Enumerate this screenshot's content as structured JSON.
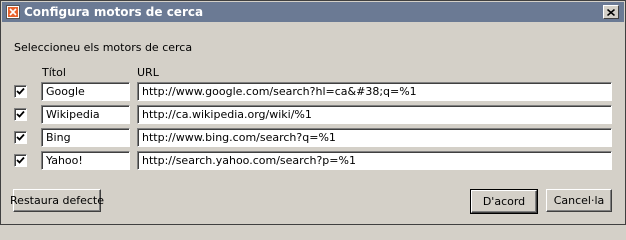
{
  "window": {
    "title": "Configura motors de cerca",
    "instruction": "Seleccioneu els motors de cerca"
  },
  "columns": {
    "title": "Títol",
    "url": "URL"
  },
  "engines": [
    {
      "checked": true,
      "title": "Google",
      "url": "http://www.google.com/search?hl=ca&#38;q=%1"
    },
    {
      "checked": true,
      "title": "Wikipedia",
      "url": "http://ca.wikipedia.org/wiki/%1"
    },
    {
      "checked": true,
      "title": "Bing",
      "url": "http://www.bing.com/search?q=%1"
    },
    {
      "checked": true,
      "title": "Yahoo!",
      "url": "http://search.yahoo.com/search?p=%1"
    }
  ],
  "buttons": {
    "restore": "Restaura defecte",
    "ok": "D'acord",
    "cancel": "Cancel·la"
  },
  "icons": {
    "app": "app-icon",
    "close": "close-icon",
    "check": "check-icon"
  }
}
